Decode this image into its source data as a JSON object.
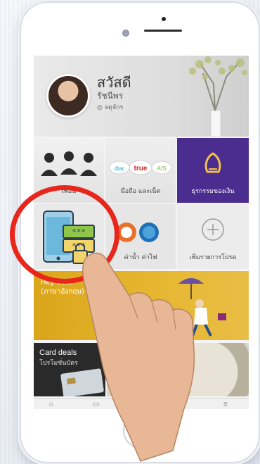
{
  "header": {
    "greeting": "สวัสดี",
    "user_name": "รัชนีพร",
    "location": "◎ จตุจักร"
  },
  "menu_tiles": [
    {
      "label": "เพื่อน",
      "icon": "people-icon"
    },
    {
      "label": "มือถือ และเน็ต",
      "icon": "mobile-topup-icon",
      "brands": [
        "true",
        "AIS",
        "dtac"
      ]
    },
    {
      "label": "ธุรกรรมของเงิน",
      "icon": "bank-logo-icon"
    },
    {
      "label": "",
      "icon": "phone-password-lock-icon"
    },
    {
      "label": "ค่าน้ำ ค่าไฟ",
      "icon": "utility-bills-icon"
    },
    {
      "label": "เพิ่มรายการโปรด",
      "icon": "plus-circle-icon"
    }
  ],
  "banner": {
    "title": "Hey bo...",
    "subtitle": "(ภาษาอังกฤษ) ..."
  },
  "card_deals": {
    "title": "Card deals",
    "subtitle": "โปรโมชั่นบัตร"
  },
  "colors": {
    "header_bg": "#e3e3e3",
    "bank_tile": "#4b2c8f",
    "banner": "#e2b12e",
    "highlight_ring": "#e8261b"
  },
  "nav_icons": [
    "home-icon",
    "card-icon",
    "transfer-icon",
    "notification-icon",
    "menu-icon"
  ]
}
